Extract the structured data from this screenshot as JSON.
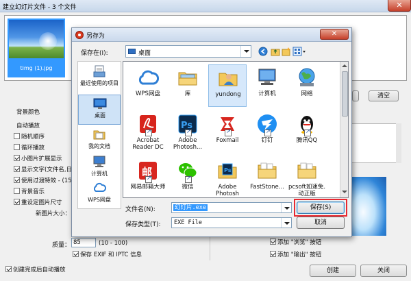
{
  "main_window": {
    "title": "建立幻灯片文件 - 3 个文件",
    "close_glyph": "✕",
    "thumbnail_label": "timg (1).jpg",
    "clear_button": "清空",
    "settings": {
      "bg_color": "背景颜色",
      "auto_play": "自动播放",
      "random_order": "随机顺序",
      "loop_play": "循环播放",
      "thumb_expand": "小图片扩展显示",
      "show_text": "显示文字(文件名,日",
      "use_transition": "使用过渡特效 - (15",
      "bg_music": "背景音乐",
      "resize_image": "重设定图片尺寸",
      "new_size_label": "新图片大小：",
      "quality_label": "质量：",
      "quality_value": "85",
      "quality_range": "(10 - 100)",
      "keep_exif": "保存 EXIF 和 IPTC 信息",
      "add_browse": "添加 \"浏览\" 按钮",
      "add_output": "添加 \"输出\" 按钮",
      "auto_play_after": "创建完成后自动播放"
    },
    "create_button": "创建",
    "close_button": "关闭"
  },
  "dialog": {
    "title": "另存为",
    "close_glyph": "✕",
    "save_in_label": "保存在(I):",
    "save_in_value": "桌面",
    "places": [
      {
        "label": "最近使用的项目",
        "icon": "recent-icon"
      },
      {
        "label": "桌面",
        "icon": "desktop-icon"
      },
      {
        "label": "我的文档",
        "icon": "documents-icon"
      },
      {
        "label": "计算机",
        "icon": "computer-icon"
      },
      {
        "label": "WPS网盘",
        "icon": "cloud-icon"
      }
    ],
    "files": [
      {
        "label": "WPS网盘",
        "icon": "cloud-icon"
      },
      {
        "label": "库",
        "icon": "library-icon"
      },
      {
        "label": "yundong",
        "icon": "user-folder-icon"
      },
      {
        "label": "计算机",
        "icon": "computer-icon"
      },
      {
        "label": "网络",
        "icon": "network-icon"
      },
      {
        "label": "Acrobat Reader DC",
        "icon": "acrobat-icon"
      },
      {
        "label": "Adobe Photosh...",
        "icon": "photoshop-icon"
      },
      {
        "label": "Foxmail",
        "icon": "foxmail-icon"
      },
      {
        "label": "钉钉",
        "icon": "dingtalk-icon"
      },
      {
        "label": "腾讯QQ",
        "icon": "qq-icon"
      },
      {
        "label": "网易邮箱大师",
        "icon": "netease-mail-icon"
      },
      {
        "label": "微信",
        "icon": "wechat-icon"
      },
      {
        "label": "Adobe Photosh",
        "icon": "photoshop-file-icon"
      },
      {
        "label": "FastStone...",
        "icon": "folder-icon"
      },
      {
        "label": "pcsoft如速免.动正版",
        "icon": "folder-icon"
      }
    ],
    "filename_label": "文件名(N):",
    "filename_value": "幻灯片.exe",
    "filetype_label": "保存类型(T):",
    "filetype_value": "EXE File",
    "save_button": "保存(S)",
    "cancel_button": "取消"
  },
  "colors": {
    "selection": "#3399ff",
    "highlight_box": "#e8272f"
  }
}
